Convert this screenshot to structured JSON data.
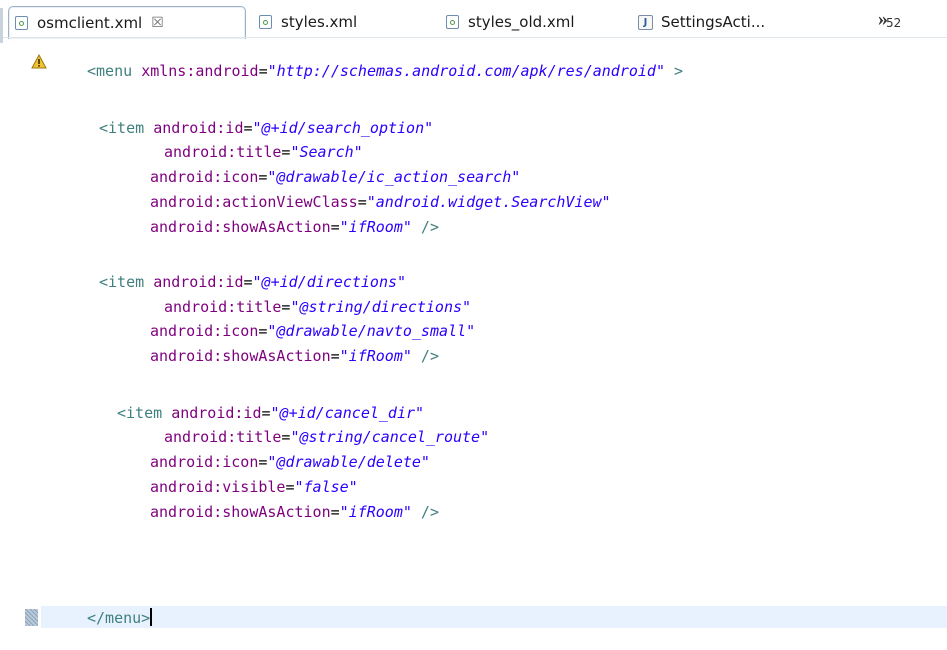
{
  "tabs": [
    {
      "label": "osmclient.xml",
      "close": "☒",
      "icon": "xml-file-icon",
      "active": true
    },
    {
      "label": "styles.xml",
      "icon": "xml-file-icon",
      "active": false
    },
    {
      "label": "styles_old.xml",
      "icon": "xml-file-icon",
      "active": false
    },
    {
      "label": "SettingsActi...",
      "icon": "java-file-icon",
      "active": false
    }
  ],
  "overflow": {
    "chevrons": "»",
    "count": "52"
  },
  "gutter": {
    "warning_icon": "warning-icon",
    "current_line_marker": "overview-marker"
  },
  "editor": {
    "line1": {
      "open": "<menu ",
      "attr": "xmlns:android",
      "eq": "=",
      "val": "\"http://schemas.android.com/apk/res/android\"",
      "close": " >"
    },
    "item1": {
      "open": "<item ",
      "id_attr": "android:id",
      "id_val": "\"@+id/search_option\"",
      "title_attr": "android:title",
      "title_val": "\"Search\"",
      "icon_attr": "android:icon",
      "icon_val": "\"@drawable/ic_action_search\"",
      "avc_attr": "android:actionViewClass",
      "avc_val": "\"android.widget.SearchView\"",
      "show_attr": "android:showAsAction",
      "show_val": "\"ifRoom\"",
      "end": " />"
    },
    "item2": {
      "open": "<item ",
      "id_attr": "android:id",
      "id_val": "\"@+id/directions\"",
      "title_attr": "android:title",
      "title_val": "\"@string/directions\"",
      "icon_attr": "android:icon",
      "icon_val": "\"@drawable/navto_small\"",
      "show_attr": "android:showAsAction",
      "show_val": "\"ifRoom\"",
      "end": " />"
    },
    "item3": {
      "open": "<item ",
      "id_attr": "android:id",
      "id_val": "\"@+id/cancel_dir\"",
      "title_attr": "android:title",
      "title_val": "\"@string/cancel_route\"",
      "icon_attr": "android:icon",
      "icon_val": "\"@drawable/delete\"",
      "vis_attr": "android:visible",
      "vis_val": "\"false\"",
      "show_attr": "android:showAsAction",
      "show_val": "\"ifRoom\"",
      "end": " />"
    },
    "closing": "</menu>",
    "eq": "="
  }
}
